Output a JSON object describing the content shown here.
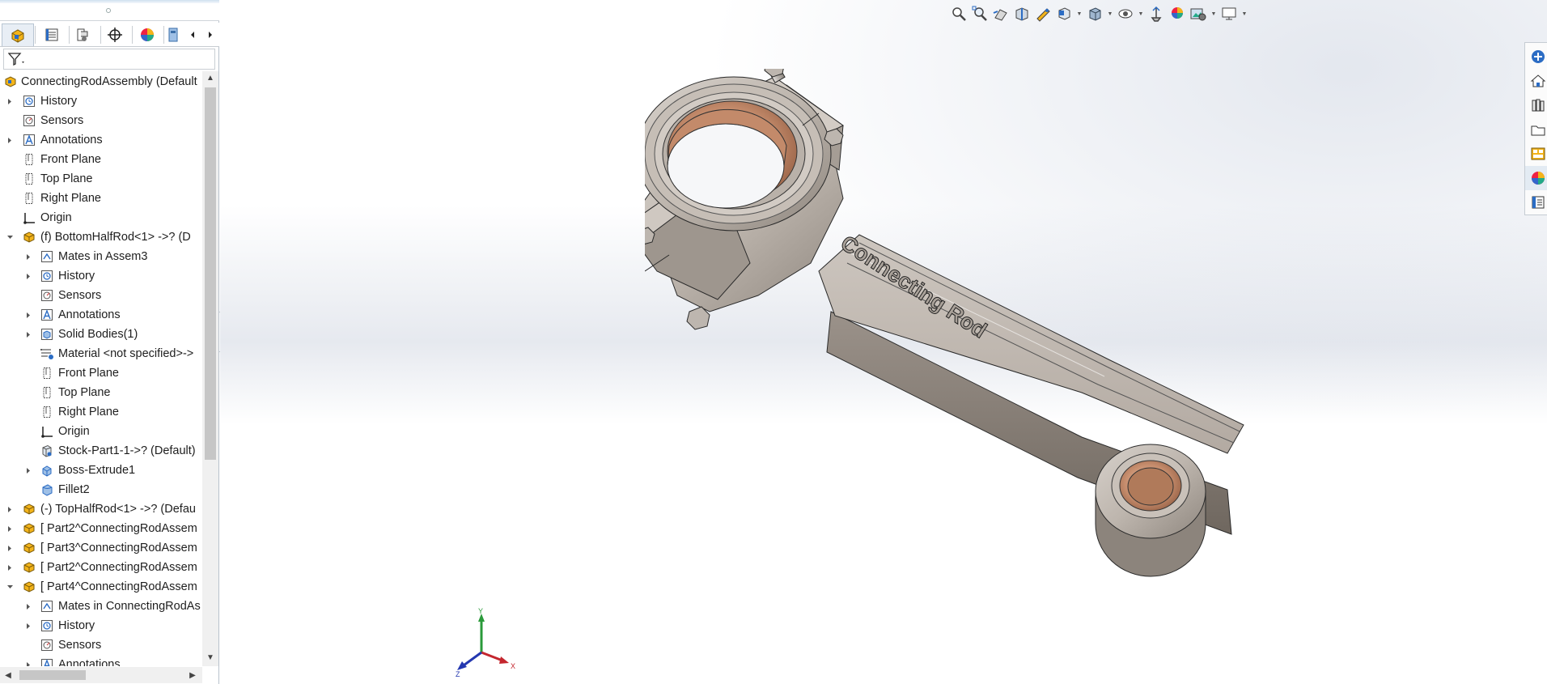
{
  "feature_manager": {
    "tabs": [
      "feature-manager-icon",
      "property-manager-icon",
      "configuration-manager-icon",
      "dimxpert-icon",
      "display-manager-icon",
      "cam-icon"
    ],
    "tree": [
      {
        "label": "ConnectingRodAssembly  (Default",
        "level": 0,
        "icon": "assembly-icon",
        "expander": "none"
      },
      {
        "label": "History",
        "level": 1,
        "icon": "history-icon",
        "expander": "collapsed"
      },
      {
        "label": "Sensors",
        "level": 1,
        "icon": "sensors-icon",
        "expander": "none"
      },
      {
        "label": "Annotations",
        "level": 1,
        "icon": "annotations-icon",
        "expander": "collapsed"
      },
      {
        "label": "Front Plane",
        "level": 1,
        "icon": "plane-icon",
        "expander": "none"
      },
      {
        "label": "Top Plane",
        "level": 1,
        "icon": "plane-icon",
        "expander": "none"
      },
      {
        "label": "Right Plane",
        "level": 1,
        "icon": "plane-icon",
        "expander": "none"
      },
      {
        "label": "Origin",
        "level": 1,
        "icon": "origin-icon",
        "expander": "none"
      },
      {
        "label": "(f) BottomHalfRod<1> ->? (D",
        "level": 1,
        "icon": "part-icon",
        "expander": "expanded"
      },
      {
        "label": "Mates in Assem3",
        "level": 2,
        "icon": "mates-icon",
        "expander": "collapsed"
      },
      {
        "label": "History",
        "level": 2,
        "icon": "history-icon",
        "expander": "collapsed"
      },
      {
        "label": "Sensors",
        "level": 2,
        "icon": "sensors-icon",
        "expander": "none"
      },
      {
        "label": "Annotations",
        "level": 2,
        "icon": "annotations-icon",
        "expander": "collapsed"
      },
      {
        "label": "Solid Bodies(1)",
        "level": 2,
        "icon": "solid-bodies-icon",
        "expander": "collapsed"
      },
      {
        "label": "Material <not specified>->",
        "level": 2,
        "icon": "material-icon",
        "expander": "none"
      },
      {
        "label": "Front Plane",
        "level": 2,
        "icon": "plane-icon",
        "expander": "none"
      },
      {
        "label": "Top Plane",
        "level": 2,
        "icon": "plane-icon",
        "expander": "none"
      },
      {
        "label": "Right Plane",
        "level": 2,
        "icon": "plane-icon",
        "expander": "none"
      },
      {
        "label": "Origin",
        "level": 2,
        "icon": "origin-icon",
        "expander": "none"
      },
      {
        "label": "Stock-Part1-1->? (Default)",
        "level": 2,
        "icon": "stock-part-icon",
        "expander": "none"
      },
      {
        "label": "Boss-Extrude1",
        "level": 2,
        "icon": "extrude-icon",
        "expander": "collapsed"
      },
      {
        "label": "Fillet2",
        "level": 2,
        "icon": "fillet-icon",
        "expander": "none"
      },
      {
        "label": "(-) TopHalfRod<1> ->? (Defau",
        "level": 1,
        "icon": "part-icon",
        "expander": "collapsed"
      },
      {
        "label": "[ Part2^ConnectingRodAssem",
        "level": 1,
        "icon": "part-icon",
        "expander": "collapsed"
      },
      {
        "label": "[ Part3^ConnectingRodAssem",
        "level": 1,
        "icon": "part-icon",
        "expander": "collapsed"
      },
      {
        "label": "[ Part2^ConnectingRodAssem",
        "level": 1,
        "icon": "part-icon",
        "expander": "collapsed"
      },
      {
        "label": "[ Part4^ConnectingRodAssem",
        "level": 1,
        "icon": "part-icon",
        "expander": "expanded"
      },
      {
        "label": "Mates in ConnectingRodAs",
        "level": 2,
        "icon": "mates-icon",
        "expander": "collapsed"
      },
      {
        "label": "History",
        "level": 2,
        "icon": "history-icon",
        "expander": "collapsed"
      },
      {
        "label": "Sensors",
        "level": 2,
        "icon": "sensors-icon",
        "expander": "none"
      },
      {
        "label": "Annotations",
        "level": 2,
        "icon": "annotations-icon",
        "expander": "collapsed"
      }
    ]
  },
  "heads_up_toolbar": [
    "zoom-to-fit-icon",
    "zoom-to-area-icon",
    "previous-view-icon",
    "section-view-icon",
    "dynamic-annotation-icon",
    "view-orientation-icon",
    "display-style-icon",
    "hide-show-items-icon",
    "edit-appearance-icon",
    "apply-scene-icon",
    "view-settings-icon"
  ],
  "task_pane": [
    "solidworks-resources-icon",
    "home-icon",
    "design-library-icon",
    "file-explorer-icon",
    "view-palette-icon",
    "appearances-icon",
    "custom-properties-icon"
  ],
  "model": {
    "engraved_text": "Connecting Rod"
  },
  "triad": {
    "x": "X",
    "y": "Y",
    "z": "Z"
  },
  "colors": {
    "accent": "#f0a20a",
    "panel_border": "#b9c2cc",
    "selection": "#e3ebf3",
    "bearing": "#c8886a",
    "metal": "#b8b0a8"
  }
}
